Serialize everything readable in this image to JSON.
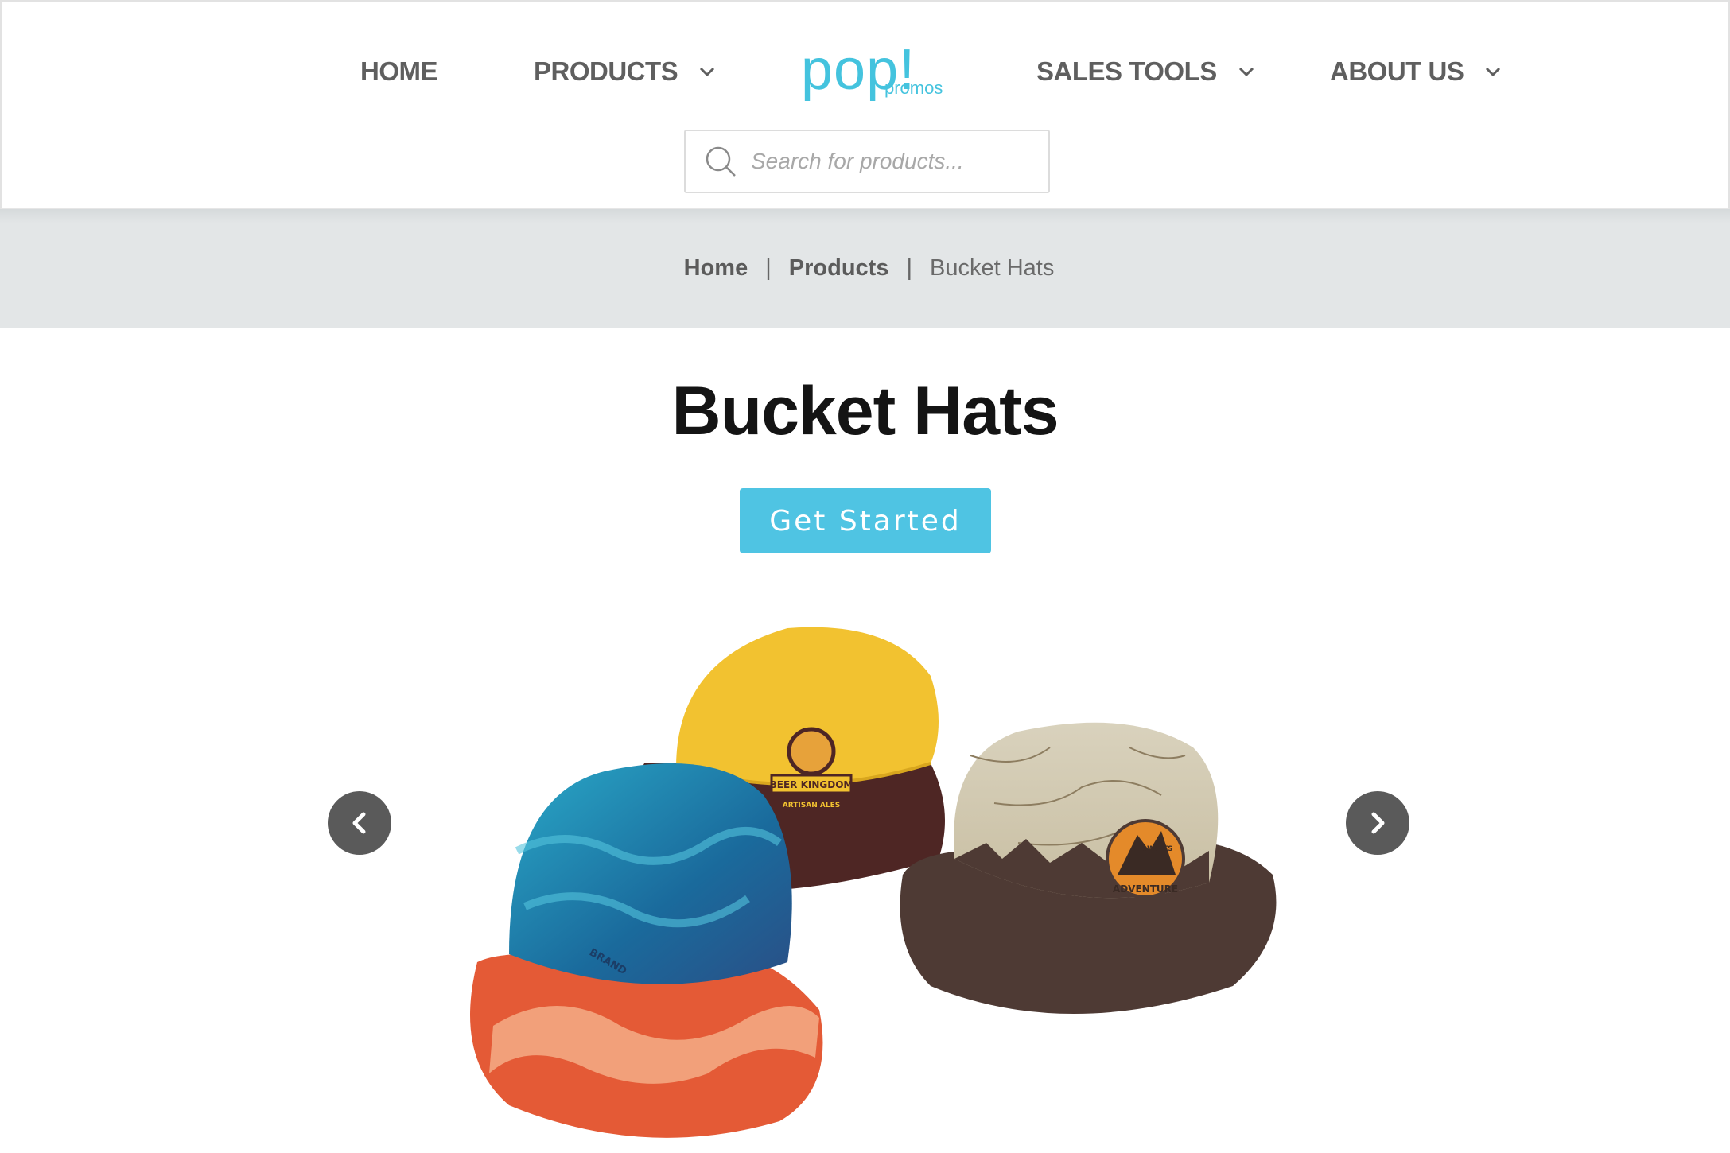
{
  "nav": {
    "home": "HOME",
    "products": "PRODUCTS",
    "sales_tools": "SALES TOOLS",
    "about_us": "ABOUT US"
  },
  "logo": {
    "main": "pop!",
    "sub": "promos"
  },
  "search": {
    "placeholder": "Search for products...",
    "value": ""
  },
  "breadcrumb": {
    "home": "Home",
    "products": "Products",
    "current": "Bucket Hats",
    "separator": "|"
  },
  "page": {
    "title": "Bucket Hats",
    "cta_label": "Get Started"
  },
  "hero": {
    "hats": [
      {
        "brand_text": "BEER KINGDOM",
        "sub_text": "ARTISAN ALES",
        "color": "#f2c230"
      },
      {
        "brand_text": "BRAND",
        "color": "#1f8fb5"
      },
      {
        "brand_text": "ADVENTURE",
        "sub_text": "AWAITS",
        "color": "#4e3a34"
      }
    ]
  },
  "colors": {
    "accent": "#4fc4e3",
    "nav_text": "#5f5f5f",
    "breadcrumb_bg": "#e3e6e7",
    "arrow_bg": "#5a5a5a"
  }
}
